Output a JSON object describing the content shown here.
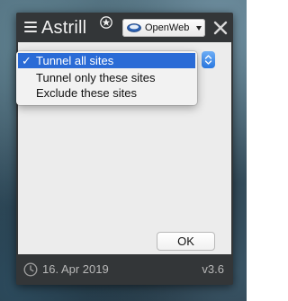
{
  "app": {
    "title": "Astrill",
    "server_label": "OpenWeb"
  },
  "dropdown": {
    "options": [
      {
        "label": "Tunnel all sites",
        "checked": true
      },
      {
        "label": "Tunnel only these sites",
        "checked": false
      },
      {
        "label": "Exclude these sites",
        "checked": false
      }
    ],
    "check_mark": "✓"
  },
  "buttons": {
    "ok_label": "OK"
  },
  "status": {
    "date": "16. Apr 2019",
    "version": "v3.6"
  },
  "icons": {
    "menu": "hamburger-menu-icon",
    "logo": "astrill-star-icon",
    "globe": "globe-icon",
    "close": "close-icon",
    "clock": "clock-icon"
  },
  "colors": {
    "window_bg": "#333638",
    "content_bg": "#ececec",
    "selection": "#2a6bd6",
    "select_arrows": "#3d89ea",
    "status_text": "#b8b8b8"
  }
}
